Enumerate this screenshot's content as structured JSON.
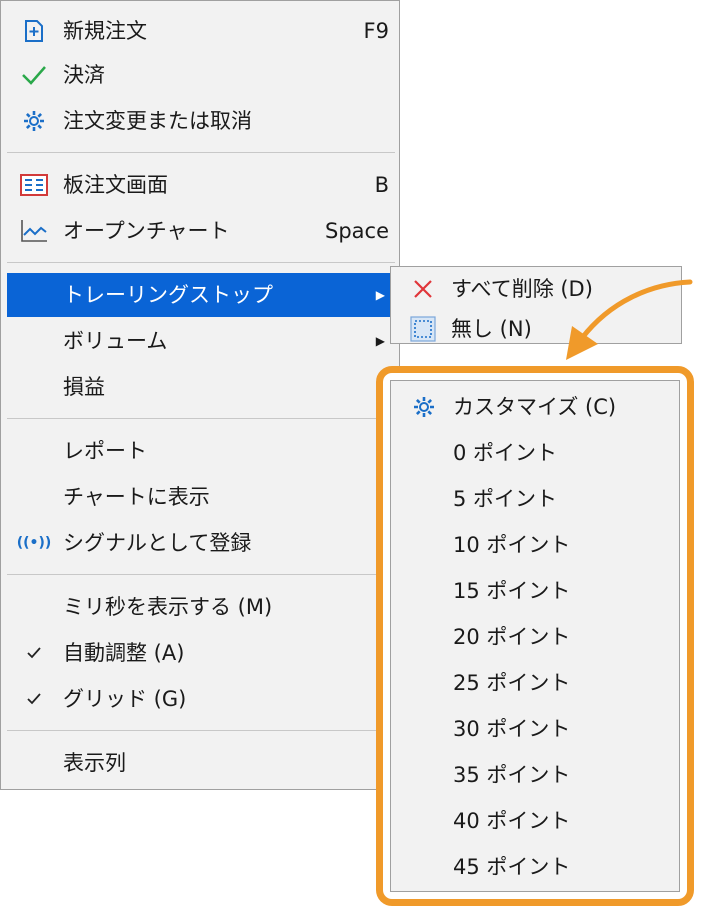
{
  "colors": {
    "accent": "#0a64d6",
    "highlight": "#f09a2a",
    "check_green": "#2aa84a",
    "icon_blue": "#1b6fc8",
    "delete_red": "#e0363a"
  },
  "context_menu": {
    "items": [
      {
        "label": "新規注文",
        "shortcut": "F9",
        "icon": "new-order-icon"
      },
      {
        "label": "決済",
        "icon": "checkmark-icon"
      },
      {
        "label": "注文変更または取消",
        "icon": "gear-icon"
      },
      {
        "label": "板注文画面",
        "shortcut": "B",
        "icon": "order-book-icon"
      },
      {
        "label": "オープンチャート",
        "shortcut": "Space",
        "icon": "chart-line-icon"
      },
      {
        "label": "トレーリングストップ",
        "submenu_arrow": "▶",
        "icon": "none"
      },
      {
        "label": "ボリューム",
        "submenu_arrow": "▶",
        "icon": "none"
      },
      {
        "label": "損益",
        "icon": "none"
      },
      {
        "label": "レポート",
        "icon": "none"
      },
      {
        "label": "チャートに表示",
        "icon": "none"
      },
      {
        "label": "シグナルとして登録",
        "icon": "signal-icon",
        "icon_glyph": "((•))"
      },
      {
        "label": "ミリ秒を表示する (M)",
        "icon": "none"
      },
      {
        "label": "自動調整 (A)",
        "icon": "checkmark-icon",
        "checked": true
      },
      {
        "label": "グリッド (G)",
        "icon": "checkmark-icon",
        "checked": true
      },
      {
        "label": "表示列",
        "icon": "none"
      }
    ]
  },
  "trailing_stop_submenu": {
    "items": [
      {
        "label": "すべて削除 (D)",
        "icon": "delete-x-icon"
      },
      {
        "label": "無し (N)",
        "icon": "dotted-box-icon"
      }
    ],
    "options": [
      {
        "label": "カスタマイズ (C)",
        "icon": "gear-icon"
      },
      {
        "label": "0 ポイント"
      },
      {
        "label": "5 ポイント"
      },
      {
        "label": "10 ポイント"
      },
      {
        "label": "15 ポイント"
      },
      {
        "label": "20 ポイント"
      },
      {
        "label": "25 ポイント"
      },
      {
        "label": "30 ポイント"
      },
      {
        "label": "35 ポイント"
      },
      {
        "label": "40 ポイント"
      },
      {
        "label": "45 ポイント"
      }
    ]
  }
}
